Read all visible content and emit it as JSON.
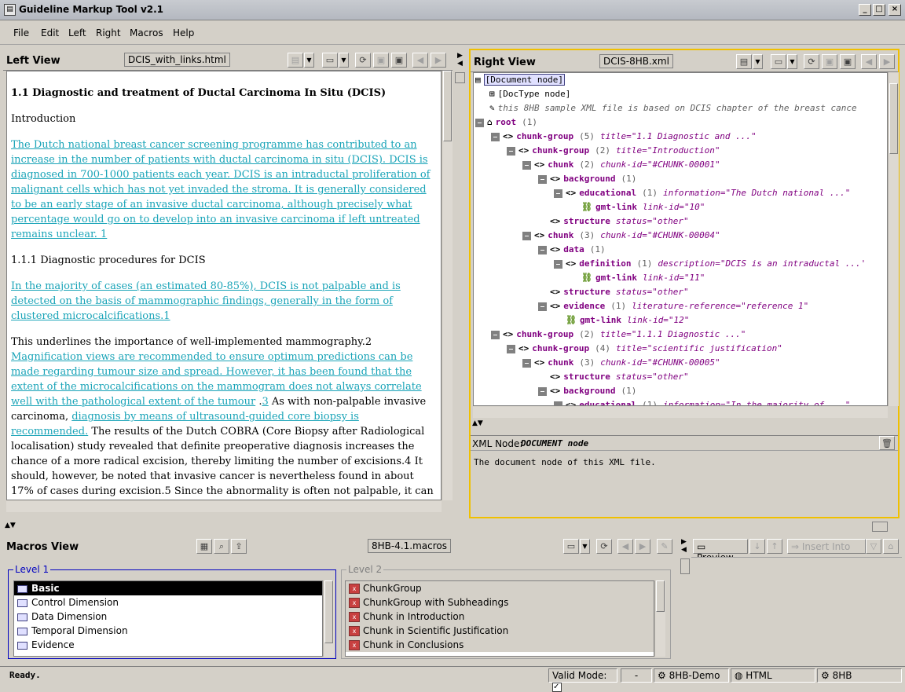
{
  "window": {
    "title": "Guideline Markup Tool v2.1"
  },
  "menu": [
    "File",
    "Edit",
    "Left",
    "Right",
    "Macros",
    "Help"
  ],
  "left_view": {
    "label": "Left View",
    "file": "DCIS_with_links.html",
    "heading": "1.1 Diagnostic and treatment of Ductal Carcinoma In Situ (DCIS)",
    "intro": "Introduction",
    "para1_link": "The Dutch national breast cancer screening programme has contributed to an increase in the number of patients with ductal carcinoma in situ (DCIS). DCIS is diagnosed in 700-1000 patients each year. DCIS is an intraductal proliferation of malignant cells which has not yet invaded the stroma. It is generally considered to be an early stage of an invasive ductal carcinoma, although precisely what percentage would go on to develop into an invasive carcinoma if left untreated remains unclear. 1",
    "sub_heading": "1.1.1 Diagnostic procedures for DCIS",
    "para2_link": "In the majority of cases (an estimated 80-85%), DCIS is not palpable and is detected on the basis of mammographic findings, generally in the form of clustered microcalcifications.1",
    "para3_a": "This underlines the importance of well-implemented mammography.2 ",
    "para3_link1": "Magnification views are recommended to ensure optimum predictions can be made regarding tumour size and spread. However, it has been found that the extent of the microcalcifications on the mammogram does not always correlate well with the pathological extent of the tumour",
    "para3_b": " .",
    "para3_link2": "3",
    "para3_c": " As with non-palpable invasive carcinoma, ",
    "para3_link3": "diagnosis by means of ultrasound-guided core biopsy is recommended.",
    "para3_d": " The results of the Dutch COBRA (Core Biopsy after Radiological localisation) study revealed that definite preoperative diagnosis increases the chance of a more radical excision, thereby limiting the number of excisions.4 It should, however, be noted that invasive cancer is nevertheless found in about 17% of cases during excision.5 Since the abnormality is often not palpable, it can be difficult to establish perioperatively whether the abnormality has been fully removed. This may be a reason for carrying out specimen radiography. By comparing this with the original mammogram, it will be possible to establish whether all the microcalcifications have been removed. Histological examination should focus on the extent of"
  },
  "right_view": {
    "label": "Right View",
    "file": "DCIS-8HB.xml",
    "tree": [
      {
        "text": "[Document node]"
      },
      {
        "text": "[DocType node]"
      },
      {
        "comment": "this 8HB sample XML file is based on DCIS chapter of the breast cance"
      },
      {
        "tag": "root",
        "count": "(1)"
      },
      {
        "tag": "chunk-group",
        "count": "(5)",
        "attr": "title=\"1.1 Diagnostic and ...\""
      },
      {
        "tag": "chunk-group",
        "count": "(2)",
        "attr": "title=\"Introduction\""
      },
      {
        "tag": "chunk",
        "count": "(2)",
        "attr": "chunk-id=\"#CHUNK-00001\""
      },
      {
        "tag": "background",
        "count": "(1)",
        "attr": ""
      },
      {
        "tag": "educational",
        "count": "(1)",
        "attr": "information=\"The Dutch national ...\""
      },
      {
        "tag": "gmt-link",
        "count": "",
        "attr": "link-id=\"10\""
      },
      {
        "tag": "structure",
        "count": "",
        "attr": "status=\"other\""
      },
      {
        "tag": "chunk",
        "count": "(3)",
        "attr": "chunk-id=\"#CHUNK-00004\""
      },
      {
        "tag": "data",
        "count": "(1)",
        "attr": ""
      },
      {
        "tag": "definition",
        "count": "(1)",
        "attr": "description=\"DCIS is an intraductal ...'"
      },
      {
        "tag": "gmt-link",
        "count": "",
        "attr": "link-id=\"11\""
      },
      {
        "tag": "structure",
        "count": "",
        "attr": "status=\"other\""
      },
      {
        "tag": "evidence",
        "count": "(1)",
        "attr": "literature-reference=\"reference 1\""
      },
      {
        "tag": "gmt-link",
        "count": "",
        "attr": "link-id=\"12\""
      },
      {
        "tag": "chunk-group",
        "count": "(2)",
        "attr": "title=\"1.1.1 Diagnostic ...\""
      },
      {
        "tag": "chunk-group",
        "count": "(4)",
        "attr": "title=\"scientific justification\""
      },
      {
        "tag": "chunk",
        "count": "(3)",
        "attr": "chunk-id=\"#CHUNK-00005\""
      },
      {
        "tag": "structure",
        "count": "",
        "attr": "status=\"other\""
      },
      {
        "tag": "background",
        "count": "(1)",
        "attr": ""
      },
      {
        "tag": "educational",
        "count": "(1)",
        "attr": "information=\"In the majority of ...\""
      }
    ],
    "xml_node_label": "XML Node:",
    "xml_node_value": "DOCUMENT node",
    "xml_node_desc": "The document node of this XML file."
  },
  "macros_view": {
    "label": "Macros View",
    "file": "8HB-4.1.macros",
    "level1_label": "Level 1",
    "level2_label": "Level 2",
    "level1": [
      "Basic",
      "Control Dimension",
      "Data Dimension",
      "Temporal Dimension",
      "Evidence"
    ],
    "level2": [
      "ChunkGroup",
      "ChunkGroup with Subheadings",
      "Chunk in Introduction",
      "Chunk in Scientific Justification",
      "Chunk in Conclusions"
    ]
  },
  "preview": {
    "preview_label": "Preview",
    "insert_label": "Insert Into"
  },
  "status": {
    "text": "Ready.",
    "valid_mode": "Valid Mode:",
    "dash": "-",
    "demo": "8HB-Demo",
    "html": "HTML",
    "hb": "8HB"
  }
}
